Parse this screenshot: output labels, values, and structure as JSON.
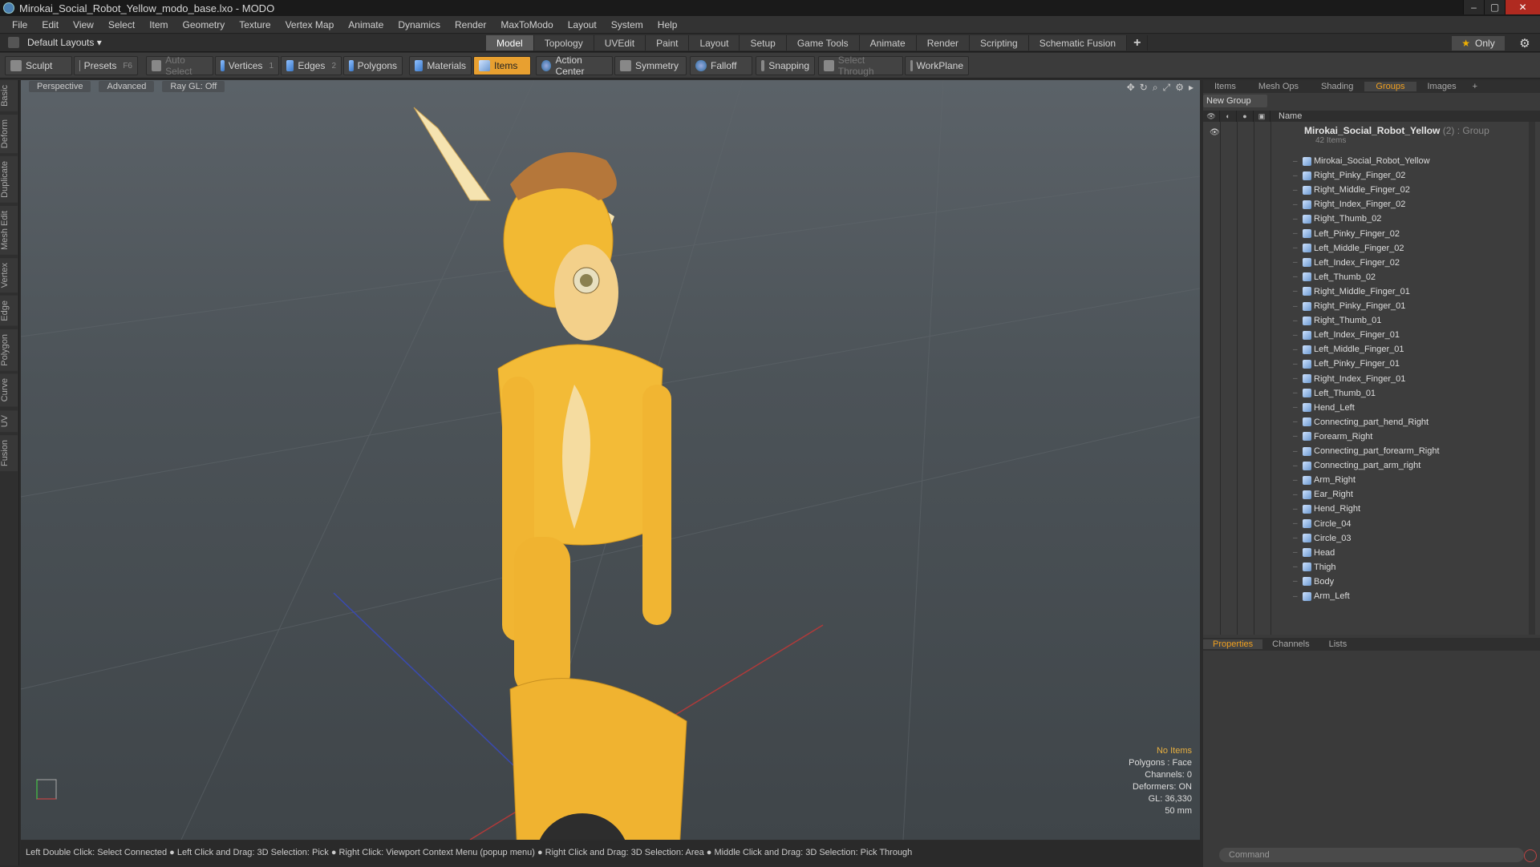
{
  "window": {
    "title": "Mirokai_Social_Robot_Yellow_modo_base.lxo - MODO",
    "controls": [
      "–",
      "▢",
      "✕"
    ]
  },
  "menu": [
    "File",
    "Edit",
    "View",
    "Select",
    "Item",
    "Geometry",
    "Texture",
    "Vertex Map",
    "Animate",
    "Dynamics",
    "Render",
    "MaxToModo",
    "Layout",
    "System",
    "Help"
  ],
  "layouts": {
    "label": "Default Layouts ▾"
  },
  "mode_tabs": [
    "Model",
    "Topology",
    "UVEdit",
    "Paint",
    "Layout",
    "Setup",
    "Game Tools",
    "Animate",
    "Render",
    "Scripting",
    "Schematic Fusion"
  ],
  "mode_tabs_active": "Model",
  "only_label": "Only",
  "toolbar": {
    "sculpt": "Sculpt",
    "presets": "Presets",
    "presets_key": "F6",
    "auto_select": "Auto Select",
    "vertices": "Vertices",
    "vertices_key": "1",
    "edges": "Edges",
    "edges_key": "2",
    "polygons": "Polygons",
    "materials": "Materials",
    "items": "Items",
    "action_center": "Action Center",
    "symmetry": "Symmetry",
    "falloff": "Falloff",
    "snapping": "Snapping",
    "select_through": "Select Through",
    "workplane": "WorkPlane"
  },
  "left_tabs": [
    "Basic",
    "Deform",
    "Duplicate",
    "Mesh Edit",
    "Vertex",
    "Edge",
    "Polygon",
    "Curve",
    "UV",
    "Fusion"
  ],
  "viewport": {
    "perspective": "Perspective",
    "advanced": "Advanced",
    "raygl": "Ray GL: Off",
    "info": {
      "no_items": "No Items",
      "polygons": "Polygons : Face",
      "channels": "Channels: 0",
      "deformers": "Deformers: ON",
      "gl": "GL: 36,330",
      "mm": "50 mm"
    }
  },
  "status": "Left Double Click: Select Connected ● Left Click and Drag: 3D Selection: Pick ● Right Click: Viewport Context Menu (popup menu) ● Right Click and Drag: 3D Selection: Area ● Middle Click and Drag: 3D Selection: Pick Through",
  "right_panel": {
    "tabs": [
      "Items",
      "Mesh Ops",
      "Shading",
      "Groups",
      "Images"
    ],
    "active_tab": "Groups",
    "new_group": "New Group",
    "name_col": "Name",
    "group": {
      "name": "Mirokai_Social_Robot_Yellow",
      "meta": " (2) : Group",
      "count": "42 Items"
    },
    "items": [
      "Mirokai_Social_Robot_Yellow",
      "Right_Pinky_Finger_02",
      "Right_Middle_Finger_02",
      "Right_Index_Finger_02",
      "Right_Thumb_02",
      "Left_Pinky_Finger_02",
      "Left_Middle_Finger_02",
      "Left_Index_Finger_02",
      "Left_Thumb_02",
      "Right_Middle_Finger_01",
      "Right_Pinky_Finger_01",
      "Right_Thumb_01",
      "Left_Index_Finger_01",
      "Left_Middle_Finger_01",
      "Left_Pinky_Finger_01",
      "Right_Index_Finger_01",
      "Left_Thumb_01",
      "Hend_Left",
      "Connecting_part_hend_Right",
      "Forearm_Right",
      "Connecting_part_forearm_Right",
      "Connecting_part_arm_right",
      "Arm_Right",
      "Ear_Right",
      "Hend_Right",
      "Circle_04",
      "Circle_03",
      "Head",
      "Thigh",
      "Body",
      "Arm_Left"
    ],
    "props_tabs": [
      "Properties",
      "Channels",
      "Lists"
    ],
    "props_active": "Properties",
    "command_placeholder": "Command"
  }
}
